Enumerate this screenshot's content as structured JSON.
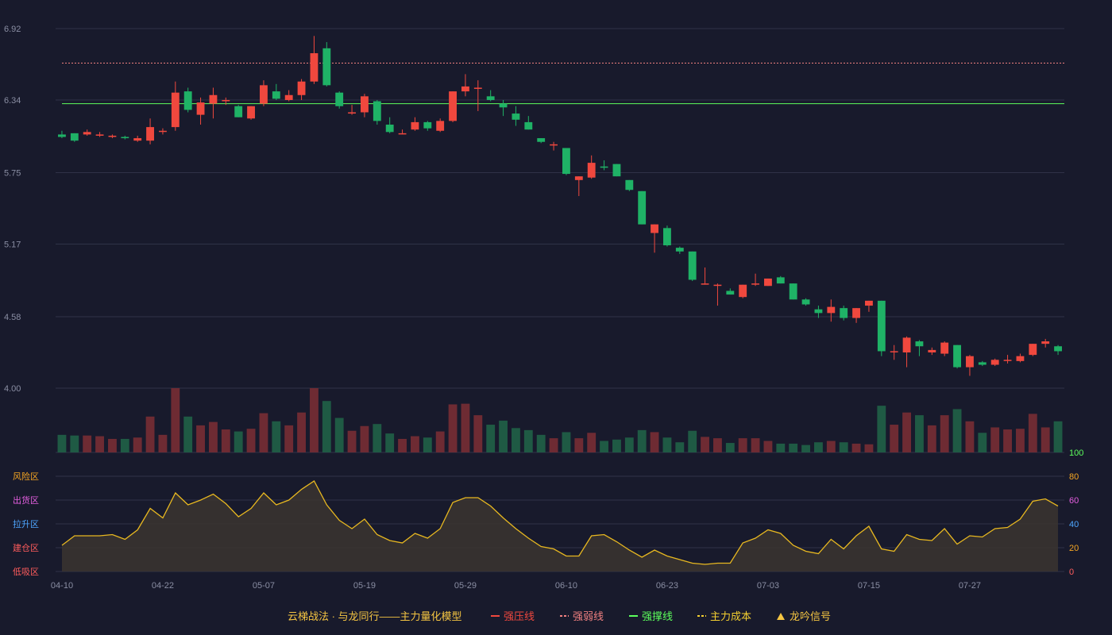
{
  "colors": {
    "background": "#181a2c",
    "grid": "#2f3247",
    "up": "#f0483e",
    "down": "#1fb266",
    "up_volume": "#6e2b33",
    "down_volume": "#1f5a44",
    "resistance": "#f0483e",
    "weak": "#f08080",
    "support": "#5cff5c",
    "cost": "#f5d030",
    "signal": "#f5c542",
    "indicator_fill": "#3b3530",
    "tick": "#8a8ea3",
    "legend_title": "#f5c542"
  },
  "chart_data": {
    "type": "candlestick",
    "price_axis": {
      "ylim": [
        4.0,
        6.92
      ],
      "ticks": [
        "6.92",
        "6.34",
        "5.75",
        "5.17",
        "4.58",
        "4.00"
      ]
    },
    "x_tick_labels": [
      {
        "index": 0,
        "label": "04-10"
      },
      {
        "index": 8,
        "label": "04-22"
      },
      {
        "index": 16,
        "label": "05-07"
      },
      {
        "index": 24,
        "label": "05-19"
      },
      {
        "index": 32,
        "label": "05-29"
      },
      {
        "index": 40,
        "label": "06-10"
      },
      {
        "index": 48,
        "label": "06-23"
      },
      {
        "index": 56,
        "label": "07-03"
      },
      {
        "index": 64,
        "label": "07-15"
      },
      {
        "index": 72,
        "label": "07-27"
      }
    ],
    "candles": [
      [
        6.06,
        6.04,
        6.09,
        6.03
      ],
      [
        6.07,
        6.01,
        6.07,
        6.0
      ],
      [
        6.06,
        6.08,
        6.1,
        6.05
      ],
      [
        6.05,
        6.06,
        6.08,
        6.04
      ],
      [
        6.04,
        6.05,
        6.06,
        6.03
      ],
      [
        6.04,
        6.03,
        6.05,
        6.02
      ],
      [
        6.01,
        6.03,
        6.05,
        6.0
      ],
      [
        6.01,
        6.12,
        6.19,
        5.98
      ],
      [
        6.09,
        6.09,
        6.11,
        6.06
      ],
      [
        6.12,
        6.4,
        6.49,
        6.09
      ],
      [
        6.41,
        6.26,
        6.44,
        6.24
      ],
      [
        6.22,
        6.32,
        6.36,
        6.14
      ],
      [
        6.31,
        6.38,
        6.44,
        6.19
      ],
      [
        6.33,
        6.34,
        6.36,
        6.3
      ],
      [
        6.29,
        6.2,
        6.3,
        6.2
      ],
      [
        6.19,
        6.29,
        6.29,
        6.18
      ],
      [
        6.31,
        6.46,
        6.5,
        6.29
      ],
      [
        6.41,
        6.35,
        6.47,
        6.34
      ],
      [
        6.34,
        6.38,
        6.42,
        6.33
      ],
      [
        6.38,
        6.49,
        6.51,
        6.34
      ],
      [
        6.49,
        6.72,
        6.86,
        6.47
      ],
      [
        6.76,
        6.46,
        6.81,
        6.45
      ],
      [
        6.4,
        6.29,
        6.41,
        6.27
      ],
      [
        6.23,
        6.24,
        6.3,
        6.22
      ],
      [
        6.24,
        6.37,
        6.39,
        6.2
      ],
      [
        6.33,
        6.17,
        6.34,
        6.14
      ],
      [
        6.14,
        6.08,
        6.2,
        6.07
      ],
      [
        6.07,
        6.07,
        6.1,
        6.06
      ],
      [
        6.1,
        6.16,
        6.2,
        6.09
      ],
      [
        6.16,
        6.11,
        6.17,
        6.09
      ],
      [
        6.09,
        6.17,
        6.19,
        6.08
      ],
      [
        6.17,
        6.41,
        6.41,
        6.16
      ],
      [
        6.41,
        6.45,
        6.55,
        6.37
      ],
      [
        6.44,
        6.44,
        6.5,
        6.25
      ],
      [
        6.37,
        6.34,
        6.42,
        6.33
      ],
      [
        6.31,
        6.28,
        6.34,
        6.21
      ],
      [
        6.23,
        6.18,
        6.29,
        6.13
      ],
      [
        6.16,
        6.1,
        6.21,
        6.1
      ],
      [
        6.03,
        6.0,
        6.03,
        5.99
      ],
      [
        5.98,
        5.98,
        6.0,
        5.93
      ],
      [
        5.95,
        5.74,
        5.95,
        5.73
      ],
      [
        5.69,
        5.72,
        5.72,
        5.56
      ],
      [
        5.71,
        5.83,
        5.89,
        5.7
      ],
      [
        5.8,
        5.79,
        5.85,
        5.77
      ],
      [
        5.82,
        5.72,
        5.82,
        5.72
      ],
      [
        5.69,
        5.61,
        5.69,
        5.6
      ],
      [
        5.6,
        5.33,
        5.6,
        5.33
      ],
      [
        5.26,
        5.33,
        5.33,
        5.1
      ],
      [
        5.3,
        5.16,
        5.32,
        5.15
      ],
      [
        5.14,
        5.11,
        5.15,
        5.09
      ],
      [
        5.11,
        4.88,
        5.11,
        4.87
      ],
      [
        4.85,
        4.85,
        4.98,
        4.84
      ],
      [
        4.84,
        4.84,
        4.85,
        4.67
      ],
      [
        4.79,
        4.76,
        4.81,
        4.76
      ],
      [
        4.74,
        4.84,
        4.84,
        4.73
      ],
      [
        4.85,
        4.85,
        4.93,
        4.83
      ],
      [
        4.83,
        4.89,
        4.89,
        4.83
      ],
      [
        4.9,
        4.85,
        4.91,
        4.85
      ],
      [
        4.85,
        4.72,
        4.85,
        4.72
      ],
      [
        4.72,
        4.68,
        4.73,
        4.67
      ],
      [
        4.64,
        4.61,
        4.67,
        4.57
      ],
      [
        4.61,
        4.66,
        4.72,
        4.54
      ],
      [
        4.65,
        4.57,
        4.67,
        4.55
      ],
      [
        4.57,
        4.65,
        4.65,
        4.53
      ],
      [
        4.67,
        4.71,
        4.71,
        4.62
      ],
      [
        4.71,
        4.3,
        4.71,
        4.26
      ],
      [
        4.3,
        4.3,
        4.35,
        4.23
      ],
      [
        4.29,
        4.41,
        4.42,
        4.17
      ],
      [
        4.38,
        4.34,
        4.39,
        4.26
      ],
      [
        4.29,
        4.31,
        4.33,
        4.27
      ],
      [
        4.28,
        4.37,
        4.38,
        4.26
      ],
      [
        4.35,
        4.17,
        4.35,
        4.16
      ],
      [
        4.17,
        4.26,
        4.27,
        4.1
      ],
      [
        4.21,
        4.19,
        4.22,
        4.18
      ],
      [
        4.19,
        4.23,
        4.24,
        4.18
      ],
      [
        4.23,
        4.23,
        4.27,
        4.2
      ],
      [
        4.22,
        4.26,
        4.28,
        4.21
      ],
      [
        4.27,
        4.36,
        4.36,
        4.26
      ],
      [
        4.36,
        4.38,
        4.4,
        4.33
      ],
      [
        4.34,
        4.3,
        4.35,
        4.27
      ]
    ],
    "volume": [
      26,
      25,
      25,
      24,
      20,
      20,
      22,
      53,
      26,
      95,
      53,
      40,
      45,
      34,
      31,
      35,
      58,
      46,
      40,
      59,
      95,
      76,
      51,
      32,
      39,
      42,
      28,
      20,
      24,
      22,
      31,
      71,
      72,
      55,
      41,
      47,
      36,
      33,
      26,
      21,
      30,
      21,
      29,
      17,
      19,
      22,
      33,
      30,
      22,
      15,
      32,
      23,
      21,
      14,
      21,
      21,
      17,
      13,
      13,
      11,
      15,
      17,
      15,
      13,
      12,
      69,
      41,
      59,
      55,
      40,
      55,
      64,
      46,
      29,
      37,
      34,
      35,
      57,
      37,
      46
    ],
    "reference_lines": {
      "resistance": 6.64,
      "support": 6.31
    },
    "indicator": {
      "ylim": [
        0,
        100
      ],
      "right_ticks": [
        "100",
        "80",
        "60",
        "40",
        "20",
        "0"
      ],
      "zones": [
        {
          "label": "风险区",
          "value": 80,
          "color": "#f5a623"
        },
        {
          "label": "出货区",
          "value": 60,
          "color": "#e55ee0"
        },
        {
          "label": "拉升区",
          "value": 40,
          "color": "#4ea6ff"
        },
        {
          "label": "建仓区",
          "value": 20,
          "color": "#ff5c5c"
        },
        {
          "label": "低吸区",
          "value": 0,
          "color": "#ff5c5c"
        }
      ],
      "values": [
        22,
        30,
        30,
        30,
        31,
        27,
        35,
        53,
        45,
        66,
        56,
        60,
        65,
        57,
        46,
        53,
        66,
        56,
        60,
        69,
        76,
        56,
        43,
        36,
        44,
        31,
        26,
        24,
        32,
        28,
        36,
        58,
        62,
        62,
        55,
        45,
        36,
        28,
        21,
        19,
        13,
        13,
        30,
        31,
        25,
        18,
        12,
        18,
        13,
        10,
        7,
        6,
        7,
        7,
        24,
        28,
        35,
        32,
        22,
        17,
        15,
        27,
        19,
        30,
        38,
        19,
        17,
        31,
        27,
        26,
        36,
        23,
        30,
        29,
        36,
        37,
        44,
        59,
        61,
        55
      ]
    },
    "legend": {
      "title": "云梯战法 · 与龙同行——主力量化模型",
      "items": [
        {
          "label": "强压线",
          "style": "solid",
          "color": "#f0483e"
        },
        {
          "label": "强弱线",
          "style": "dashed",
          "color": "#f08080"
        },
        {
          "label": "强撑线",
          "style": "solid",
          "color": "#5cff5c"
        },
        {
          "label": "主力成本",
          "style": "dashed",
          "color": "#f5d030"
        },
        {
          "label": "龙吟信号",
          "style": "triangle",
          "color": "#f5c542"
        }
      ]
    }
  }
}
